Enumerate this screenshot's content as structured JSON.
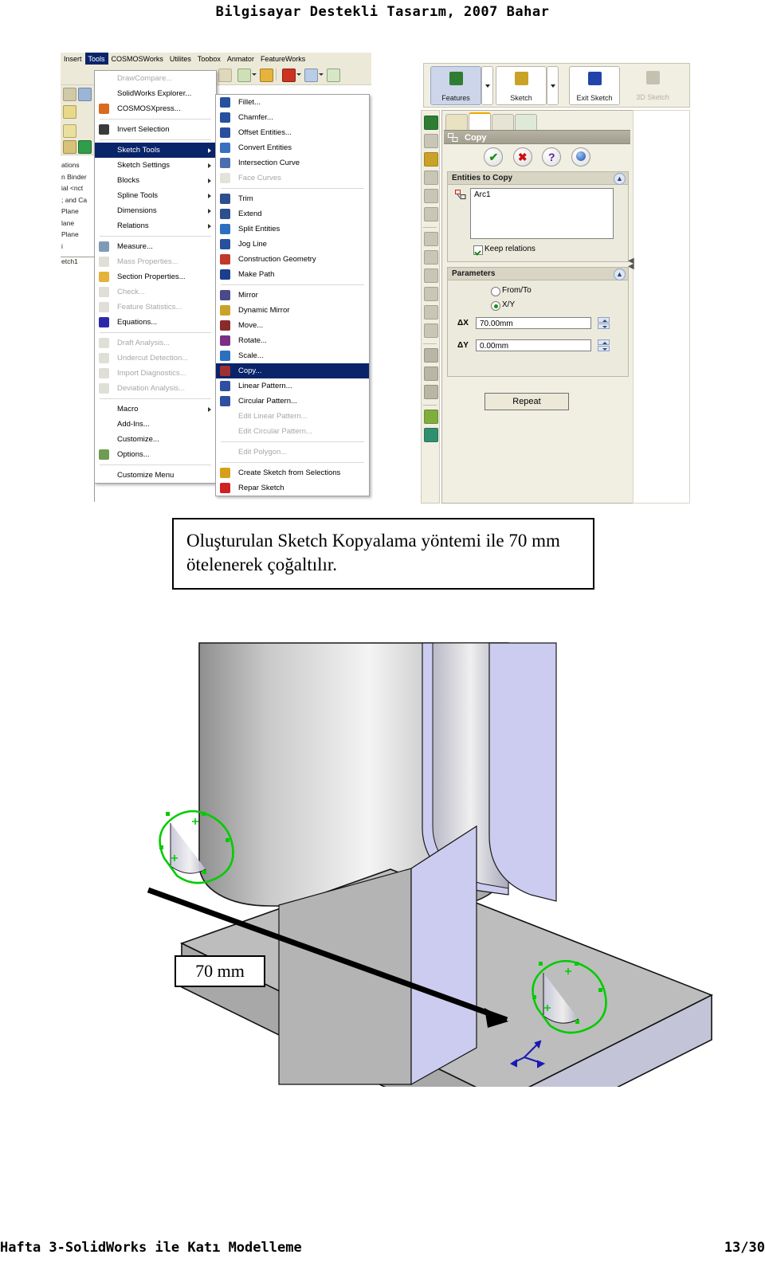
{
  "page": {
    "header_title": "Bilgisayar Destekli Tasarım, 2007 Bahar",
    "footer_text": "Hafta 3-SolidWorks ile Katı Modelleme",
    "footer_page": "13/30"
  },
  "caption": {
    "text": "Oluşturulan Sketch Kopyalama yöntemi ile 70 mm ötelenerek çoğaltılır."
  },
  "screenshot": {
    "menubar": [
      {
        "label": "Insert",
        "active": false
      },
      {
        "label": "Tools",
        "active": true
      },
      {
        "label": "COSMOSWorks",
        "active": false
      },
      {
        "label": "Utilites",
        "active": false
      },
      {
        "label": "Toobox",
        "active": false
      },
      {
        "label": "Anmator",
        "active": false
      },
      {
        "label": "FeatureWorks",
        "active": false
      }
    ],
    "tools_menu": [
      {
        "label": "DrawCompare...",
        "disabled": true,
        "submenu": false,
        "highlight": false,
        "icon": "none"
      },
      {
        "label": "SolidWorks Explorer...",
        "disabled": false,
        "submenu": false,
        "highlight": false,
        "icon": "none"
      },
      {
        "label": "COSMOSXpress...",
        "disabled": false,
        "submenu": false,
        "highlight": false,
        "icon": "cosmosxpress-icon"
      },
      {
        "separator": true
      },
      {
        "label": "Invert Selection",
        "disabled": false,
        "submenu": false,
        "highlight": false,
        "icon": "invert-selection-icon"
      },
      {
        "separator": true
      },
      {
        "label": "Sketch Tools",
        "disabled": false,
        "submenu": true,
        "highlight": true,
        "icon": "none"
      },
      {
        "label": "Sketch Settings",
        "disabled": false,
        "submenu": true,
        "highlight": false,
        "icon": "none"
      },
      {
        "label": "Blocks",
        "disabled": false,
        "submenu": true,
        "highlight": false,
        "icon": "none"
      },
      {
        "label": "Spline Tools",
        "disabled": false,
        "submenu": true,
        "highlight": false,
        "icon": "none"
      },
      {
        "label": "Dimensions",
        "disabled": false,
        "submenu": true,
        "highlight": false,
        "icon": "none"
      },
      {
        "label": "Relations",
        "disabled": false,
        "submenu": true,
        "highlight": false,
        "icon": "none"
      },
      {
        "separator": true
      },
      {
        "label": "Measure...",
        "disabled": false,
        "submenu": false,
        "highlight": false,
        "icon": "measure-icon"
      },
      {
        "label": "Mass Properties...",
        "disabled": true,
        "submenu": false,
        "highlight": false,
        "icon": "mass-properties-icon"
      },
      {
        "label": "Section Properties...",
        "disabled": false,
        "submenu": false,
        "highlight": false,
        "icon": "section-properties-icon"
      },
      {
        "label": "Check...",
        "disabled": true,
        "submenu": false,
        "highlight": false,
        "icon": "check-icon"
      },
      {
        "label": "Feature Statistics...",
        "disabled": true,
        "submenu": false,
        "highlight": false,
        "icon": "feature-statistics-icon"
      },
      {
        "label": "Equations...",
        "disabled": false,
        "submenu": false,
        "highlight": false,
        "icon": "equations-icon"
      },
      {
        "separator": true
      },
      {
        "label": "Draft Analysis...",
        "disabled": true,
        "submenu": false,
        "highlight": false,
        "icon": "draft-analysis-icon"
      },
      {
        "label": "Undercut Detection...",
        "disabled": true,
        "submenu": false,
        "highlight": false,
        "icon": "undercut-detection-icon"
      },
      {
        "label": "Import Diagnostics...",
        "disabled": true,
        "submenu": false,
        "highlight": false,
        "icon": "import-diagnostics-icon"
      },
      {
        "label": "Deviation Analysis...",
        "disabled": true,
        "submenu": false,
        "highlight": false,
        "icon": "deviation-analysis-icon"
      },
      {
        "separator": true
      },
      {
        "label": "Macro",
        "disabled": false,
        "submenu": true,
        "highlight": false,
        "icon": "none"
      },
      {
        "label": "Add-Ins...",
        "disabled": false,
        "submenu": false,
        "highlight": false,
        "icon": "none"
      },
      {
        "label": "Customize...",
        "disabled": false,
        "submenu": false,
        "highlight": false,
        "icon": "none"
      },
      {
        "label": "Options...",
        "disabled": false,
        "submenu": false,
        "highlight": false,
        "icon": "options-icon"
      },
      {
        "separator": true
      },
      {
        "label": "Customize Menu",
        "disabled": false,
        "submenu": false,
        "highlight": false,
        "icon": "none"
      }
    ],
    "sketch_tools_submenu": [
      {
        "label": "Fillet...",
        "disabled": false,
        "highlight": false,
        "icon": "fillet-icon"
      },
      {
        "label": "Chamfer...",
        "disabled": false,
        "highlight": false,
        "icon": "chamfer-icon"
      },
      {
        "label": "Offset Entities...",
        "disabled": false,
        "highlight": false,
        "icon": "offset-entities-icon"
      },
      {
        "label": "Convert Entities",
        "disabled": false,
        "highlight": false,
        "icon": "convert-entities-icon"
      },
      {
        "label": "Intersection Curve",
        "disabled": false,
        "highlight": false,
        "icon": "intersection-curve-icon"
      },
      {
        "label": "Face Curves",
        "disabled": true,
        "highlight": false,
        "icon": "face-curves-icon"
      },
      {
        "separator": true
      },
      {
        "label": "Trim",
        "disabled": false,
        "highlight": false,
        "icon": "trim-icon"
      },
      {
        "label": "Extend",
        "disabled": false,
        "highlight": false,
        "icon": "extend-icon"
      },
      {
        "label": "Split Entities",
        "disabled": false,
        "highlight": false,
        "icon": "split-entities-icon"
      },
      {
        "label": "Jog Line",
        "disabled": false,
        "highlight": false,
        "icon": "jog-line-icon"
      },
      {
        "label": "Construction Geometry",
        "disabled": false,
        "highlight": false,
        "icon": "construction-geometry-icon"
      },
      {
        "label": "Make Path",
        "disabled": false,
        "highlight": false,
        "icon": "make-path-icon"
      },
      {
        "separator": true
      },
      {
        "label": "Mirror",
        "disabled": false,
        "highlight": false,
        "icon": "mirror-icon"
      },
      {
        "label": "Dynamic Mirror",
        "disabled": false,
        "highlight": false,
        "icon": "dynamic-mirror-icon"
      },
      {
        "label": "Move...",
        "disabled": false,
        "highlight": false,
        "icon": "move-icon"
      },
      {
        "label": "Rotate...",
        "disabled": false,
        "highlight": false,
        "icon": "rotate-icon"
      },
      {
        "label": "Scale...",
        "disabled": false,
        "highlight": false,
        "icon": "scale-icon"
      },
      {
        "label": "Copy...",
        "disabled": false,
        "highlight": true,
        "icon": "copy-icon"
      },
      {
        "label": "Linear Pattern...",
        "disabled": false,
        "highlight": false,
        "icon": "linear-pattern-icon"
      },
      {
        "label": "Circular Pattern...",
        "disabled": false,
        "highlight": false,
        "icon": "circular-pattern-icon"
      },
      {
        "label": "Edit Linear Pattern...",
        "disabled": true,
        "highlight": false,
        "icon": "none"
      },
      {
        "label": "Edit Circular Pattern...",
        "disabled": true,
        "highlight": false,
        "icon": "none"
      },
      {
        "separator": true
      },
      {
        "label": "Edit Polygon...",
        "disabled": true,
        "highlight": false,
        "icon": "none"
      },
      {
        "separator": true
      },
      {
        "label": "Create Sketch from Selections",
        "disabled": false,
        "highlight": false,
        "icon": "create-sketch-from-selections-icon"
      },
      {
        "label": "Repar Sketch",
        "disabled": false,
        "highlight": false,
        "icon": "repair-sketch-icon"
      }
    ],
    "feature_tree_fragments": [
      "ations",
      "n Binder",
      "ial <nct",
      "; and Ca",
      " Plane",
      "lane",
      " Plane",
      "i",
      "etch1"
    ],
    "command_manager": [
      {
        "label": "Features",
        "state": "selected",
        "icon": "features-icon",
        "dropdown": true
      },
      {
        "label": "Sketch",
        "state": "normal",
        "icon": "sketch-icon",
        "dropdown": true
      },
      {
        "label": "Exit Sketch",
        "state": "normal",
        "icon": "exit-sketch-icon",
        "dropdown": false
      },
      {
        "label": "3D Sketch",
        "state": "disabled",
        "icon": "3d-sketch-icon",
        "dropdown": false
      }
    ],
    "property_manager": {
      "tabs": [
        {
          "name": "feature-manager-tab",
          "active": false
        },
        {
          "name": "property-manager-tab",
          "active": true
        },
        {
          "name": "configuration-manager-tab",
          "active": false
        },
        {
          "name": "display-manager-tab",
          "active": false
        }
      ],
      "title": "Copy",
      "actions": [
        {
          "name": "ok-button",
          "glyph": "✔",
          "color": "#179317"
        },
        {
          "name": "cancel-button",
          "glyph": "✖",
          "color": "#cc1111"
        },
        {
          "name": "help-button",
          "glyph": "?",
          "color": "#5423a8"
        },
        {
          "name": "pin-button",
          "glyph": "●",
          "color": "#2255bb"
        }
      ],
      "entities_group": {
        "title": "Entities to Copy",
        "selection_value": "Arc1",
        "keep_relations_label": "Keep relations",
        "keep_relations_checked": true
      },
      "parameters_group": {
        "title": "Parameters",
        "radio_from_to": "From/To",
        "radio_xy": "X/Y",
        "selected_mode": "X/Y",
        "dx_label": "ΔX",
        "dx_value": "70.00mm",
        "dy_label": "ΔY",
        "dy_value": "0.00mm"
      },
      "repeat_label": "Repeat"
    }
  },
  "model_view": {
    "dimension_label": "70 mm",
    "sketch_color": "#00cc00",
    "part_color": "#bdbdbd",
    "highlight_color": "#ccccf0"
  }
}
